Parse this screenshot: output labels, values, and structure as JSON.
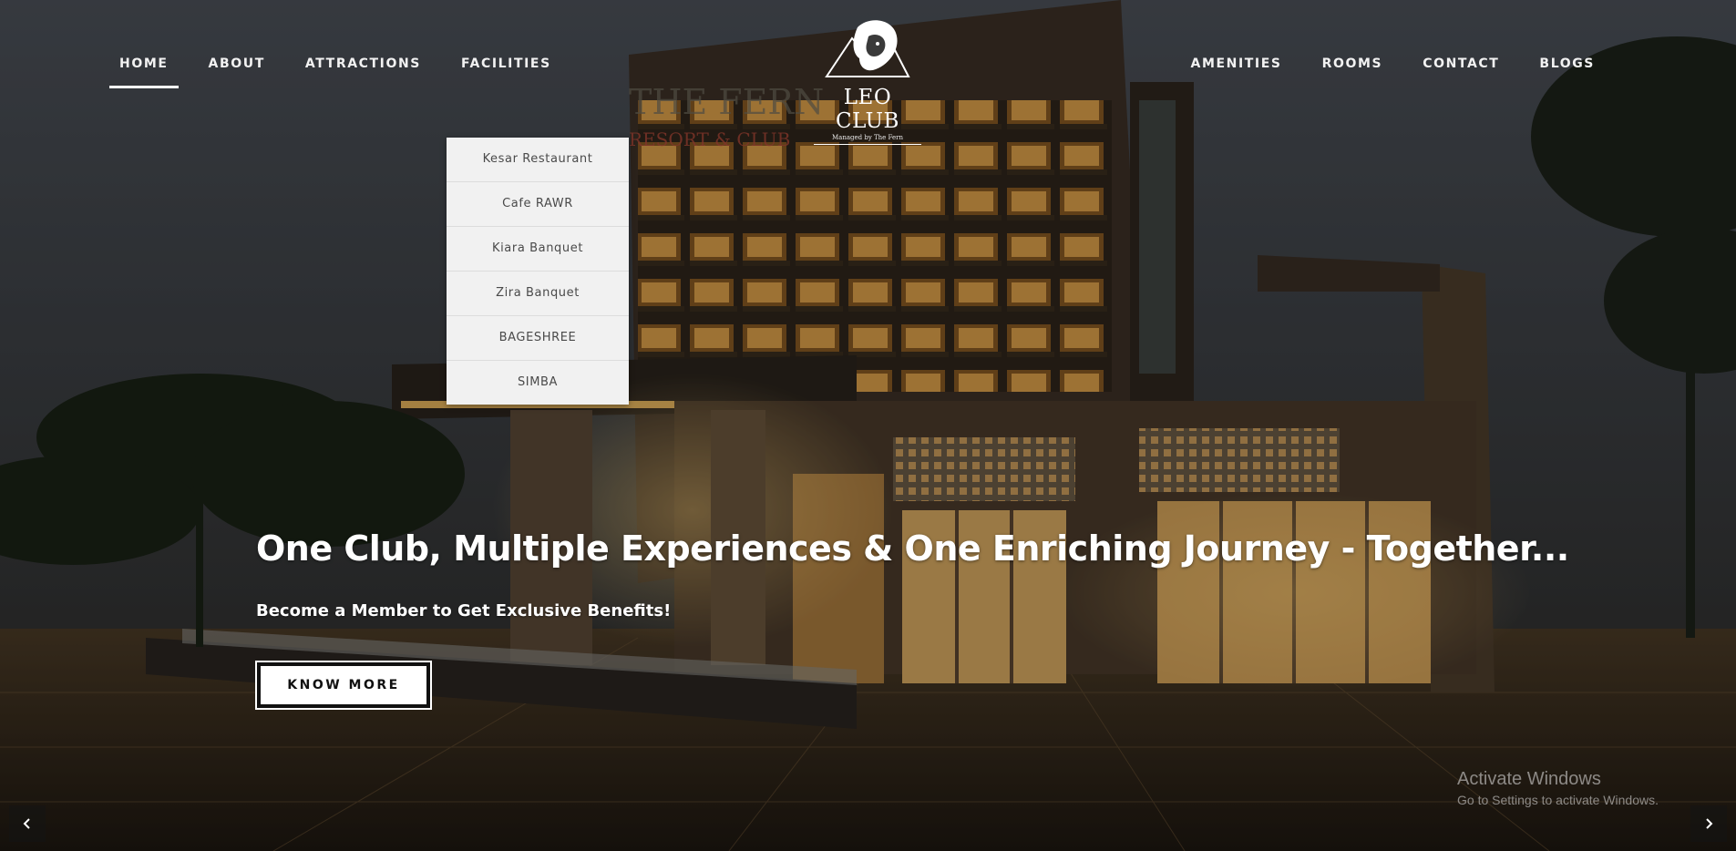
{
  "nav": {
    "left": [
      {
        "label": "HOME",
        "active": true
      },
      {
        "label": "ABOUT"
      },
      {
        "label": "ATTRACTIONS"
      },
      {
        "label": "FACILITIES"
      }
    ],
    "right": [
      {
        "label": "AMENITIES"
      },
      {
        "label": "ROOMS"
      },
      {
        "label": "CONTACT"
      },
      {
        "label": "BLOGS"
      }
    ]
  },
  "logo": {
    "name": "LEO CLUB",
    "tagline": "Managed by The Fern"
  },
  "facilities_dropdown": {
    "items": [
      "Kesar Restaurant",
      "Cafe RAWR",
      "Kiara Banquet",
      "Zira Banquet",
      "BAGESHREE",
      "SIMBA"
    ]
  },
  "hero": {
    "title": "One Club, Multiple Experiences & One Enriching Journey - Together...",
    "subtitle": "Become a Member to Get Exclusive Benefits!",
    "cta_label": "KNOW MORE"
  },
  "slider": {
    "prev_icon": "chevron-left-icon",
    "next_icon": "chevron-right-icon"
  },
  "watermark": {
    "title": "Activate Windows",
    "subtitle": "Go to Settings to activate Windows."
  },
  "colors": {
    "nav_text": "#f2f2f2",
    "dropdown_bg": "#f1f1f1",
    "dropdown_text": "#4a4a4a",
    "cta_bg": "#ffffff",
    "building_light": "#d9a24a"
  }
}
